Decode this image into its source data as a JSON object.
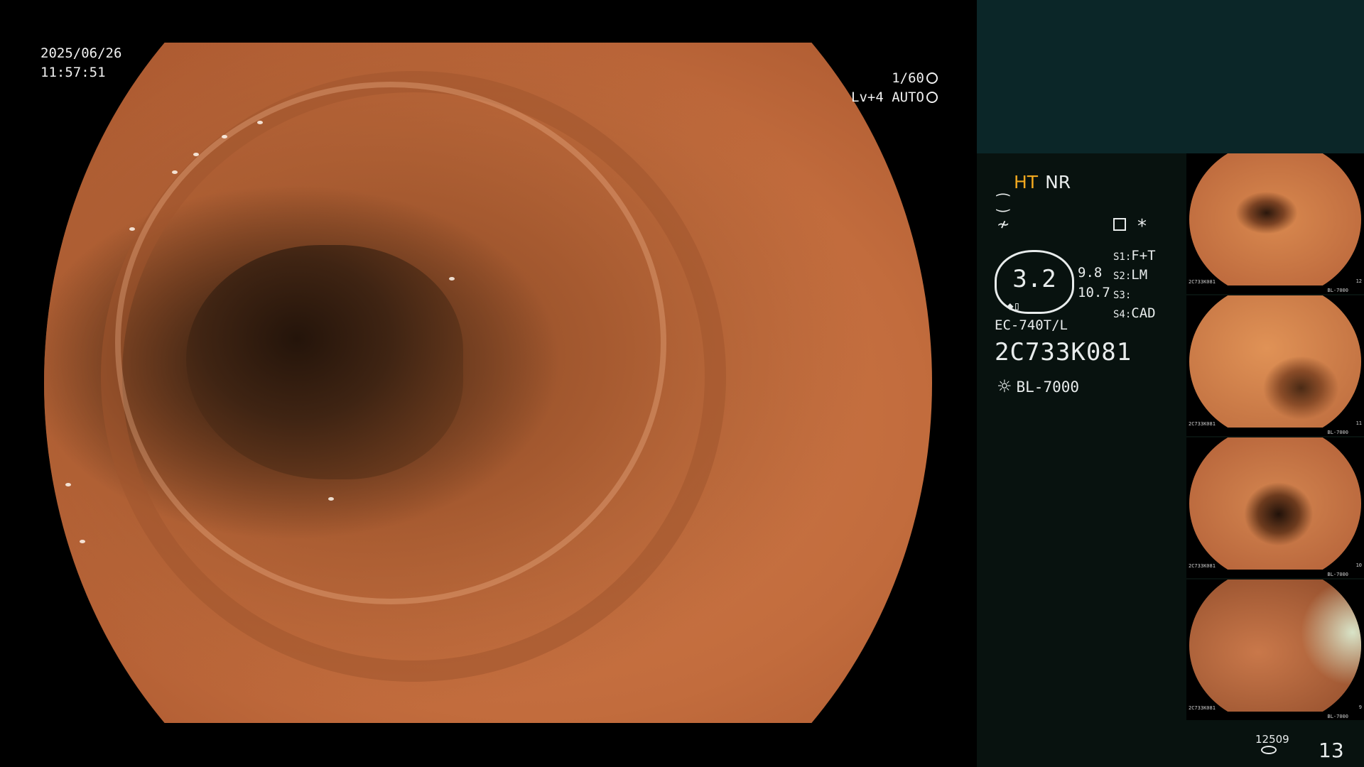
{
  "image_overlay": {
    "date": "2025/06/26",
    "time": "11:57:51",
    "shutter": "1/60",
    "iris": "Lv+4 AUTO"
  },
  "panel": {
    "enhance_ht": "HT",
    "enhance_nr": "NR",
    "zoom_value": "3.2",
    "zoom_side_top": "9.8",
    "zoom_side_bottom": "10.7",
    "switches": [
      {
        "key": "S1:",
        "value": "F+T"
      },
      {
        "key": "S2:",
        "value": "LM"
      },
      {
        "key": "S3:",
        "value": ""
      },
      {
        "key": "S4:",
        "value": "CAD"
      }
    ],
    "scope_model": "EC-740T/L",
    "scope_serial": "2C733K081",
    "light_source": "BL-7000",
    "icons": {
      "structure": "structure-enhance-icon",
      "color": "color-enhance-icon",
      "memo": "memo-icon",
      "star": "asterisk-icon"
    }
  },
  "thumbnails": [
    {
      "serial": "2C733K081",
      "index": "12"
    },
    {
      "serial": "2C733K081",
      "index": "11"
    },
    {
      "serial": "2C733K081",
      "index": "10"
    },
    {
      "serial": "2C733K081",
      "index": "9"
    }
  ],
  "footer": {
    "capture_count": "12509",
    "page": "13"
  },
  "colors": {
    "highlight": "#f1a81f",
    "panel_top": "#0b2628",
    "panel_main": "#08120f"
  }
}
